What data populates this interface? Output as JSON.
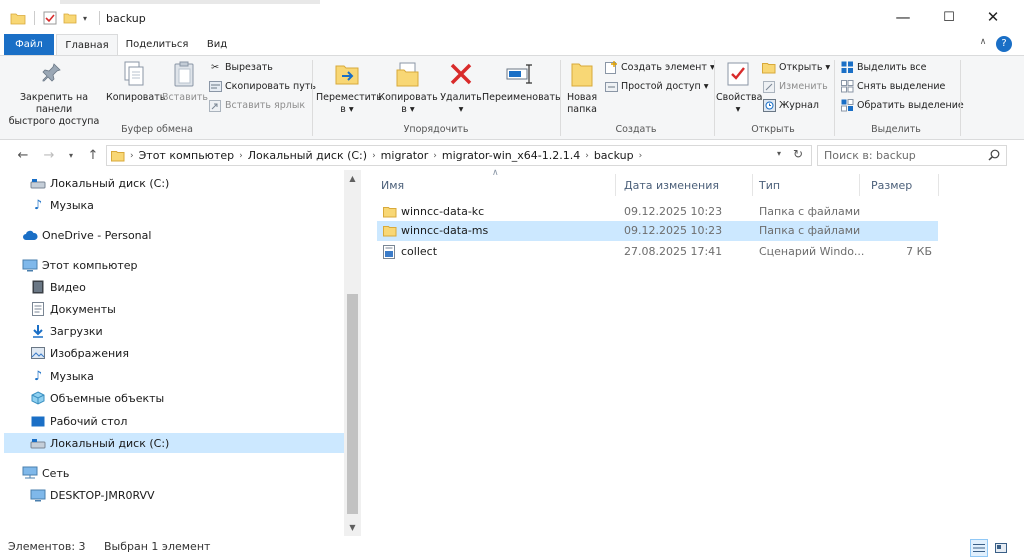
{
  "window": {
    "title": "backup",
    "controls": {
      "minimize": "—",
      "maximize": "☐",
      "close": "✕"
    }
  },
  "ribbon_tabs": {
    "file": "Файл",
    "home": "Главная",
    "share": "Поделиться",
    "view": "Вид"
  },
  "clipboard": {
    "pin": [
      "Закрепить на панели",
      "быстрого доступа"
    ],
    "copy": "Копировать",
    "paste": "Вставить",
    "cut": "Вырезать",
    "copy_path": "Скопировать путь",
    "paste_shortcut": "Вставить ярлык",
    "group": "Буфер обмена"
  },
  "organize": {
    "move_to": [
      "Переместить",
      "в ▾"
    ],
    "copy_to": [
      "Копировать",
      "в ▾"
    ],
    "delete": [
      "Удалить",
      "▾"
    ],
    "rename": "Переименовать",
    "group": "Упорядочить"
  },
  "new": {
    "new_folder": [
      "Новая",
      "папка"
    ],
    "new_item": "Создать элемент ▾",
    "easy_access": "Простой доступ ▾",
    "group": "Создать"
  },
  "open": {
    "properties": [
      "Свойства",
      "▾"
    ],
    "open": "Открыть ▾",
    "edit": "Изменить",
    "history": "Журнал",
    "group": "Открыть"
  },
  "select": {
    "select_all": "Выделить все",
    "select_none": "Снять выделение",
    "invert": "Обратить выделение",
    "group": "Выделить"
  },
  "address": {
    "crumbs": [
      "Этот компьютер",
      "Локальный диск (C:)",
      "migrator",
      "migrator-win_x64-1.2.1.4",
      "backup"
    ],
    "search_placeholder": "Поиск в: backup"
  },
  "nav": {
    "items": [
      "Локальный диск (C:)",
      "Музыка",
      "OneDrive - Personal",
      "Этот компьютер",
      "Видео",
      "Документы",
      "Загрузки",
      "Изображения",
      "Музыка",
      "Объемные объекты",
      "Рабочий стол",
      "Локальный диск (C:)",
      "Сеть",
      "DESKTOP-JMR0RVV"
    ],
    "selected_index": 11
  },
  "columns": {
    "name": "Имя",
    "date": "Дата изменения",
    "type": "Тип",
    "size": "Размер"
  },
  "files": [
    {
      "name": "winncc-data-kc",
      "date": "09.12.2025 10:23",
      "type": "Папка с файлами",
      "size": "",
      "icon": "folder-icon",
      "selected": false
    },
    {
      "name": "winncc-data-ms",
      "date": "09.12.2025 10:23",
      "type": "Папка с файлами",
      "size": "",
      "icon": "folder-icon",
      "selected": true
    },
    {
      "name": "collect",
      "date": "27.08.2025 17:41",
      "type": "Сценарий Windo...",
      "size": "7 КБ",
      "icon": "script-icon",
      "selected": false
    }
  ],
  "status": {
    "count": "Элементов: 3",
    "selected": "Выбран 1 элемент"
  },
  "colors": {
    "accent": "#1a6fc6",
    "selection": "#cce8ff",
    "folder": "#f8d775",
    "delete_red": "#d92b2b"
  }
}
